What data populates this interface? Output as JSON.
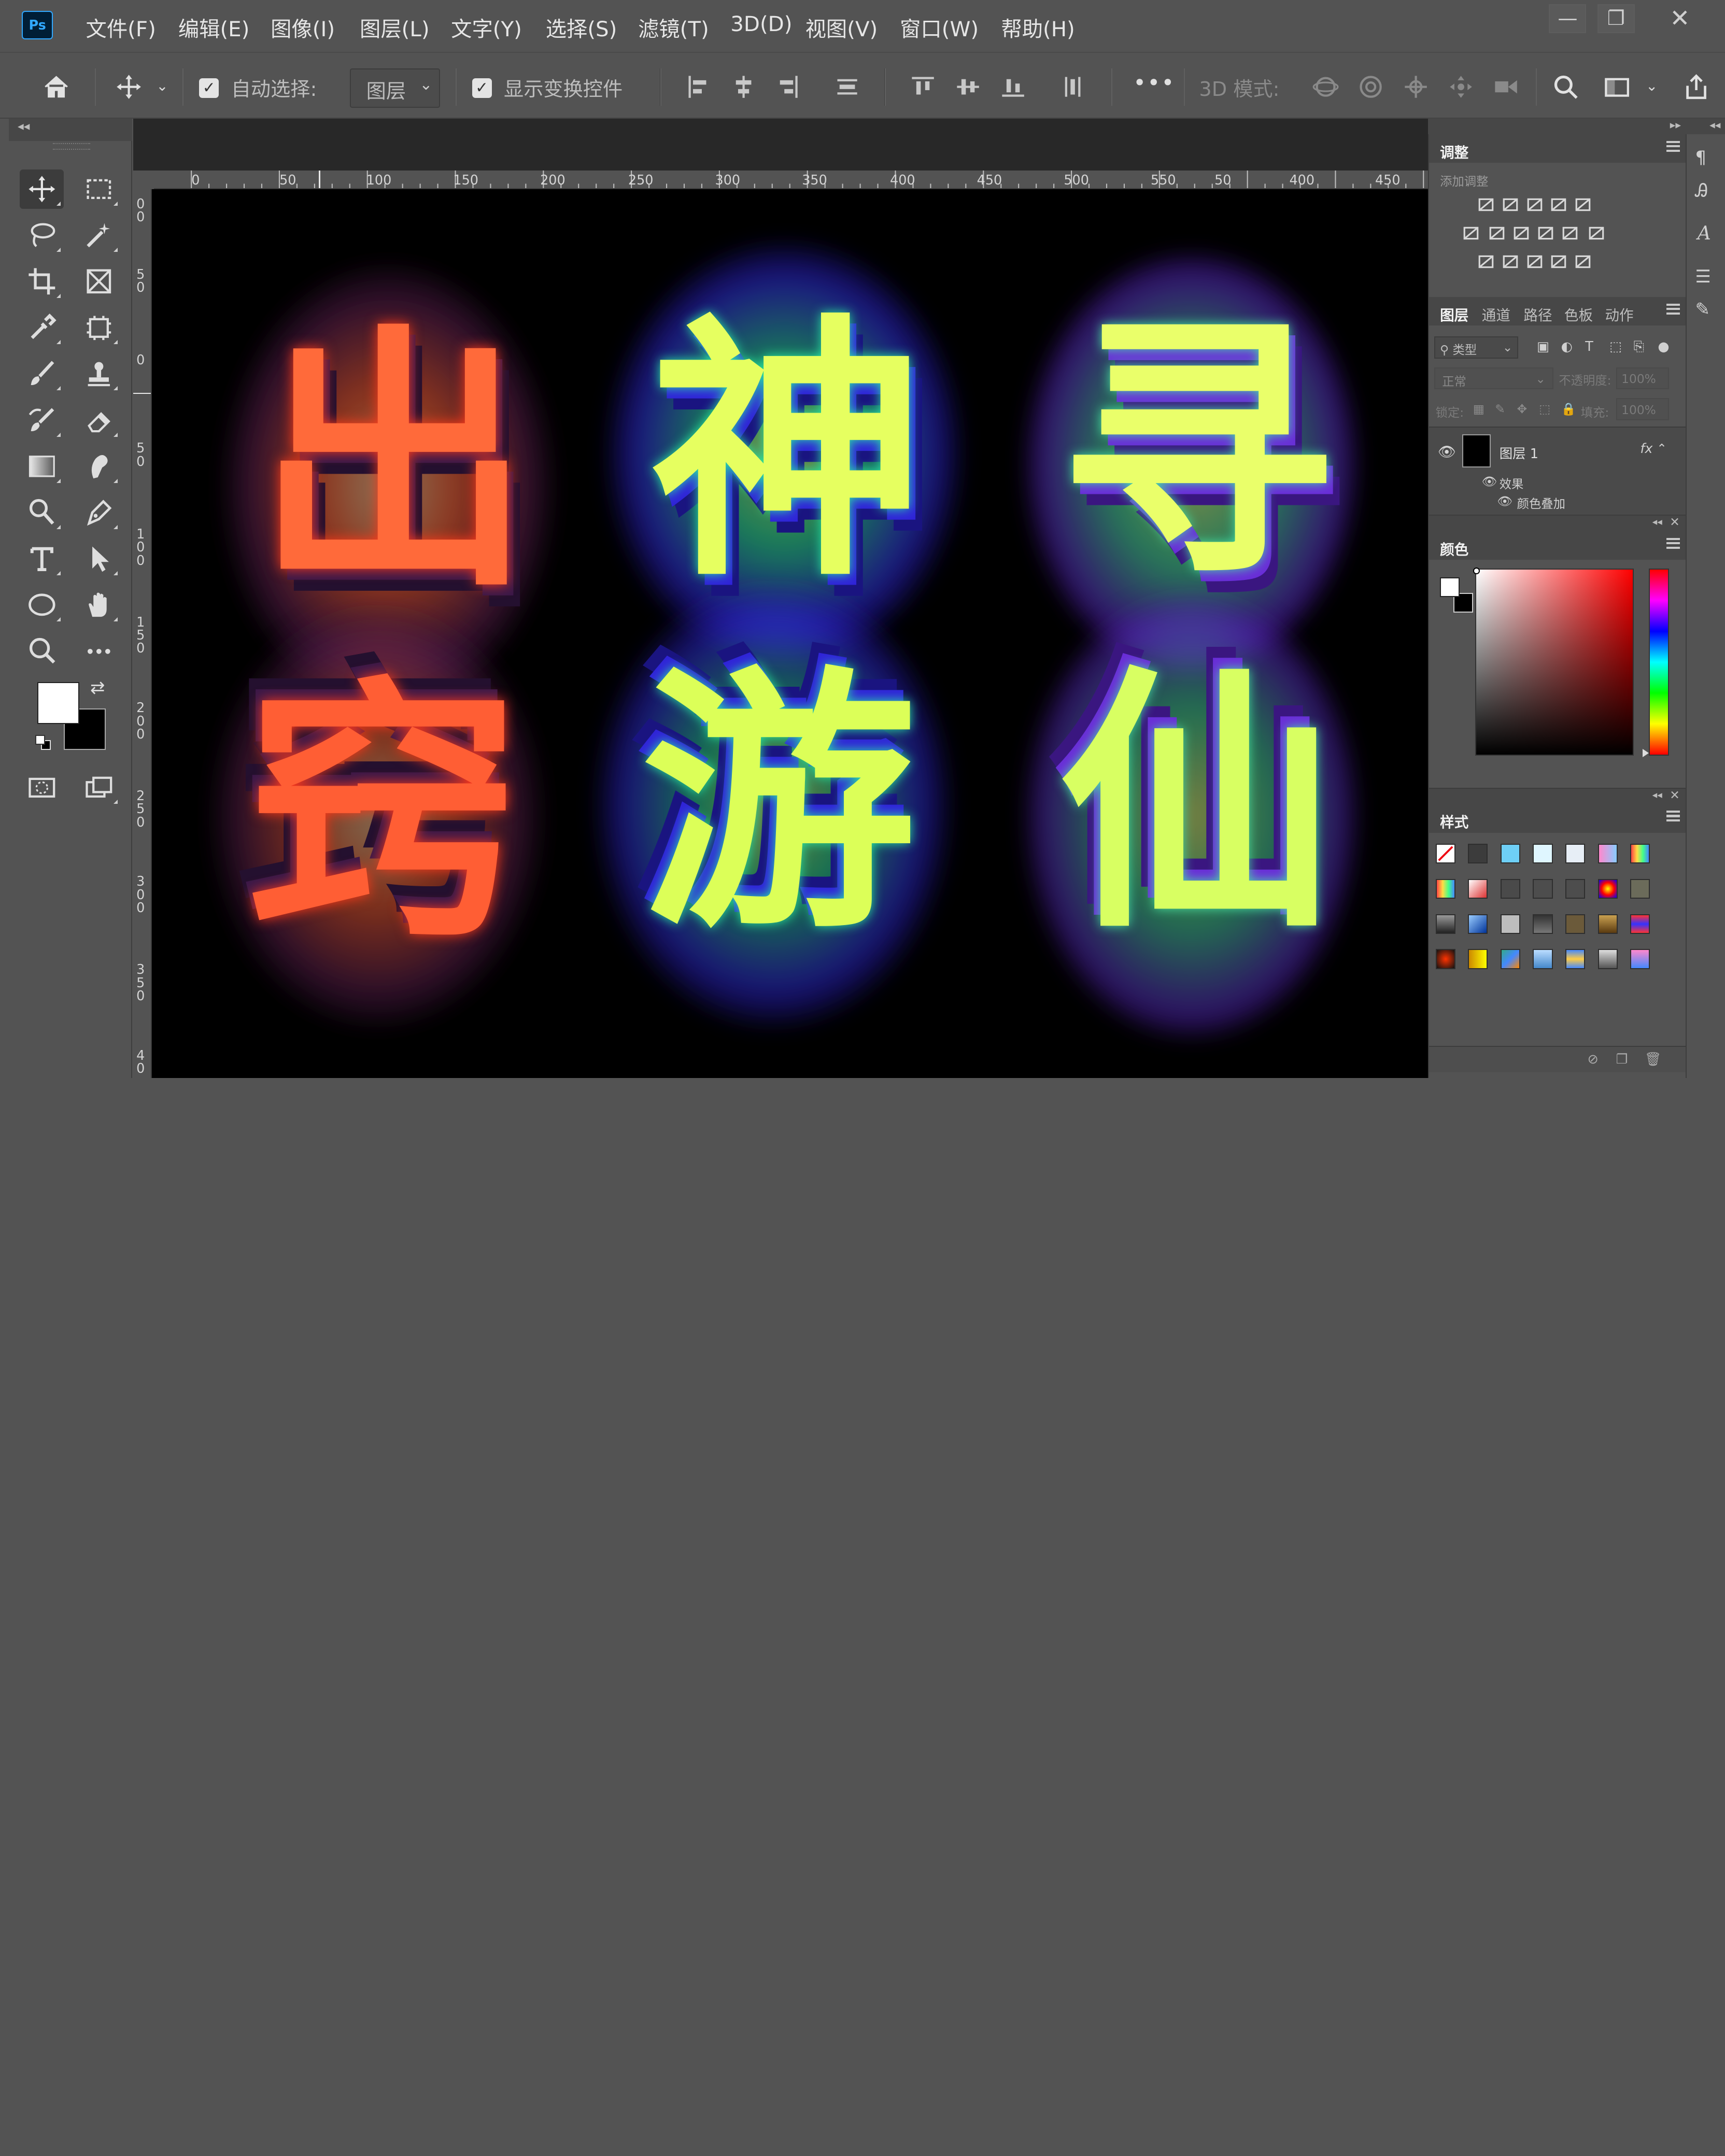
{
  "app": {
    "logo": "Ps",
    "menu": [
      "文件(F)",
      "编辑(E)",
      "图像(I)",
      "图层(L)",
      "文字(Y)",
      "选择(S)",
      "滤镜(T)",
      "3D(D)",
      "视图(V)",
      "窗口(W)",
      "帮助(H)"
    ],
    "window_controls": {
      "minimize": "—",
      "maximize": "❐",
      "close": "✕"
    }
  },
  "options_bar": {
    "auto_select_label": "自动选择:",
    "auto_select_checked": true,
    "auto_select_target": "图层",
    "show_transform_label": "显示变换控件",
    "show_transform_checked": true,
    "more": "•••",
    "mode_3d_label": "3D 模式:"
  },
  "toolbar": {
    "collapse_glyph": "◂◂",
    "foreground_color": "#ffffff",
    "background_color": "#000000",
    "tools": [
      "move-tool",
      "rectangular-marquee-tool",
      "lasso-tool",
      "magic-wand-tool",
      "crop-tool",
      "frame-tool",
      "eyedropper-tool",
      "content-aware-tool",
      "brush-tool",
      "clone-stamp-tool",
      "history-brush-tool",
      "eraser-tool",
      "gradient-tool",
      "smudge-tool",
      "dodge-tool",
      "pen-tool",
      "type-tool",
      "path-selection-tool",
      "ellipse-tool",
      "hand-tool",
      "zoom-tool",
      "more-tools",
      "quick-mask-tool",
      "screen-mode-tool"
    ]
  },
  "rulers": {
    "horizontal": [
      "0",
      "50",
      "100",
      "150",
      "200",
      "250",
      "300",
      "350",
      "400",
      "450",
      "500",
      "550",
      "50",
      "400",
      "450"
    ],
    "vertical": [
      "00",
      "50",
      "0",
      "50",
      "100",
      "150",
      "200",
      "250",
      "300",
      "350",
      "40"
    ]
  },
  "canvas": {
    "characters": [
      {
        "top": "出",
        "bottom": "窍",
        "colors": [
          "#ff6a3a",
          "#ffd7a8",
          "#3a1a5a"
        ]
      },
      {
        "top": "神",
        "bottom": "游",
        "colors": [
          "#e8ff5a",
          "#2eea9a",
          "#3a2cff"
        ]
      },
      {
        "top": "寻",
        "bottom": "仙",
        "colors": [
          "#eaff6a",
          "#46e0a0",
          "#6a2cd8"
        ]
      }
    ]
  },
  "adjustments_panel": {
    "tab": "调整",
    "subtitle": "添加调整"
  },
  "layers_panel": {
    "tabs": [
      "图层",
      "通道",
      "路径",
      "色板",
      "动作"
    ],
    "active_tab": "图层",
    "filter_label": "类型",
    "blend_mode": "正常",
    "opacity_label": "不透明度:",
    "opacity_value": "100%",
    "lock_label": "锁定:",
    "fill_label": "填充:",
    "fill_value": "100%",
    "layers": [
      {
        "name": "图层 1",
        "visible": true,
        "fx": "fx",
        "effects_label": "效果",
        "effects": [
          "颜色叠加"
        ]
      }
    ]
  },
  "color_panel": {
    "tab": "颜色",
    "hue": "#ff0000"
  },
  "styles_panel": {
    "tab": "样式"
  }
}
